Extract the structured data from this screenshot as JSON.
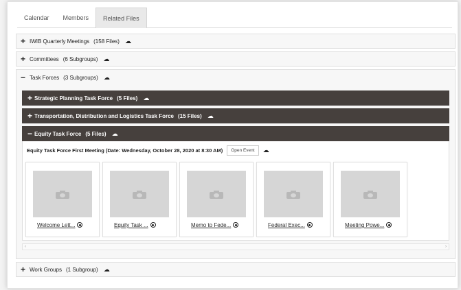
{
  "tabs": [
    "Calendar",
    "Members",
    "Related Files"
  ],
  "groups": [
    {
      "sign": "+",
      "name": "IWIB Quarterly Meetings",
      "count": "(158 Files)"
    },
    {
      "sign": "+",
      "name": "Committees",
      "count": "(6 Subgroups)"
    },
    {
      "sign": "−",
      "name": "Task Forces",
      "count": "(3 Subgroups)"
    }
  ],
  "task_forces": [
    {
      "sign": "+",
      "name": "Strategic Planning Task Force",
      "count": "(5 Files)"
    },
    {
      "sign": "+",
      "name": "Transportation, Distribution and Logistics Task Force",
      "count": "(15 Files)"
    },
    {
      "sign": "−",
      "name": "Equity Task Force",
      "count": "(5 Files)"
    }
  ],
  "meeting": {
    "title": "Equity Task Force First Meeting (Date: Wednesday, October 28, 2020 at 8:30 AM)",
    "open_event_label": "Open Event"
  },
  "files": [
    {
      "name": "Welcome Lett..."
    },
    {
      "name": "Equity Task ..."
    },
    {
      "name": "Memo to Fede..."
    },
    {
      "name": "Federal Exec..."
    },
    {
      "name": "Meeting Powe..."
    }
  ],
  "scroll": {
    "left": "‹",
    "right": "›"
  },
  "bottom_group": {
    "sign": "+",
    "name": "Work Groups",
    "count": "(1 Subgroup)"
  },
  "icons": {
    "group_action": "cloud-download-icon",
    "file_action": "view-icon",
    "thumbnail": "camera-icon"
  },
  "colors": {
    "dark_header": "#46403d",
    "active_tab": "#e9e9e9"
  }
}
